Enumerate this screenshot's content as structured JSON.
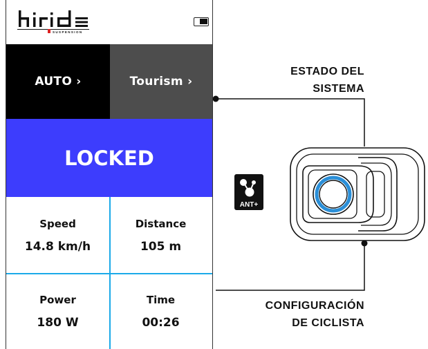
{
  "header": {
    "logo_text": "hiride",
    "logo_subtext": "SUSPENSION",
    "battery_icon": "battery-icon"
  },
  "modes": {
    "auto_label": "AUTO ›",
    "tourism_label": "Tourism ›"
  },
  "status": {
    "label": "LOCKED",
    "color": "#3d3dfd"
  },
  "metrics": [
    {
      "label": "Speed",
      "value": "14.8 km/h"
    },
    {
      "label": "Distance",
      "value": "105 m"
    },
    {
      "label": "Power",
      "value": "180 W"
    },
    {
      "label": "Time",
      "value": "00:26"
    }
  ],
  "callouts": {
    "system_state": [
      "ESTADO DEL",
      "SISTEMA"
    ],
    "rider_config": [
      "CONFIGURACIÓN",
      "DE CICLISTA"
    ]
  },
  "badge": {
    "label": "ANT+"
  },
  "colors": {
    "divider": "#1aa9e8",
    "auto_bg": "#000000",
    "tourism_bg": "#4d4d4d",
    "button_ring": "#2a8fd8"
  }
}
